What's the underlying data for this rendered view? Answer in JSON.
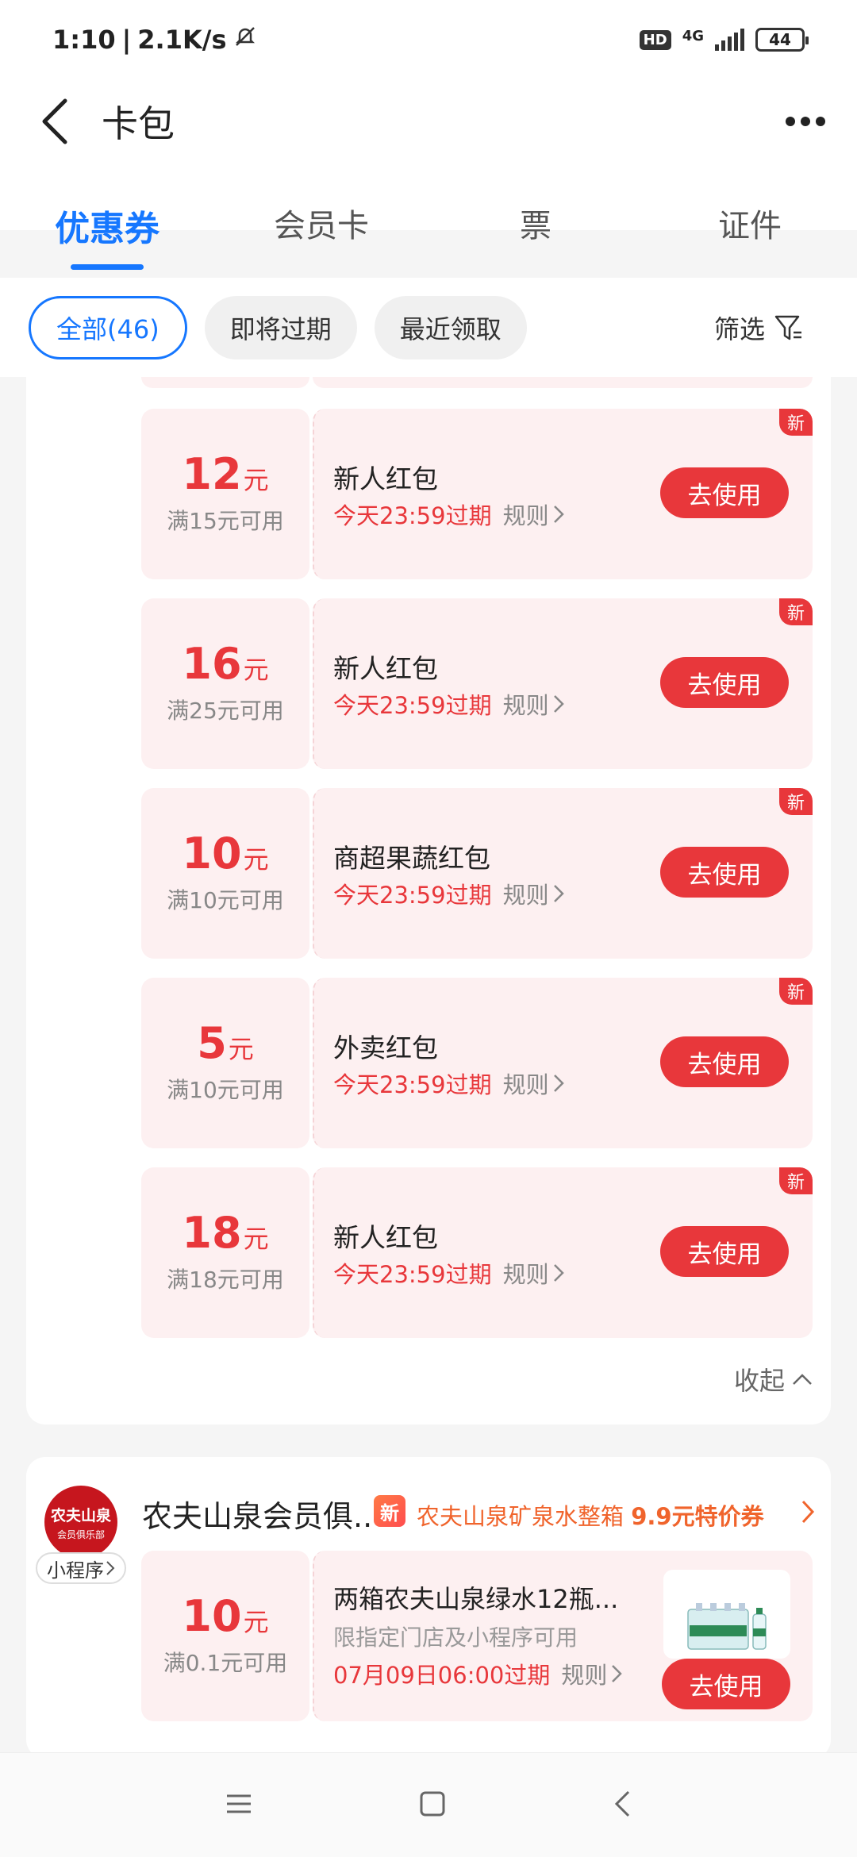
{
  "status_bar": {
    "time": "1:10",
    "speed": "2.1K/s",
    "hd": "HD",
    "network": "4G",
    "battery": "44"
  },
  "header": {
    "title": "卡包"
  },
  "tabs": [
    {
      "label": "优惠券",
      "active": true
    },
    {
      "label": "会员卡",
      "active": false
    },
    {
      "label": "票",
      "active": false
    },
    {
      "label": "证件",
      "active": false
    }
  ],
  "filters": {
    "chips": [
      "全部(46)",
      "即将过期",
      "最近领取"
    ],
    "filter_label": "筛选"
  },
  "coupons": [
    {
      "amount": "12",
      "unit": "元",
      "condition": "满15元可用",
      "name": "新人红包",
      "expire": "今天23:59过期",
      "rules": "规则",
      "button": "去使用",
      "badge": "新"
    },
    {
      "amount": "16",
      "unit": "元",
      "condition": "满25元可用",
      "name": "新人红包",
      "expire": "今天23:59过期",
      "rules": "规则",
      "button": "去使用",
      "badge": "新"
    },
    {
      "amount": "10",
      "unit": "元",
      "condition": "满10元可用",
      "name": "商超果蔬红包",
      "expire": "今天23:59过期",
      "rules": "规则",
      "button": "去使用",
      "badge": "新"
    },
    {
      "amount": "5",
      "unit": "元",
      "condition": "满10元可用",
      "name": "外卖红包",
      "expire": "今天23:59过期",
      "rules": "规则",
      "button": "去使用",
      "badge": "新"
    },
    {
      "amount": "18",
      "unit": "元",
      "condition": "满18元可用",
      "name": "新人红包",
      "expire": "今天23:59过期",
      "rules": "规则",
      "button": "去使用",
      "badge": "新"
    }
  ],
  "collapse_label": "收起",
  "merchant": {
    "logo_line1": "农夫山泉",
    "logo_line2": "会员俱乐部",
    "mini_program": "小程序",
    "name": "农夫山泉会员俱...",
    "promo_badge": "新",
    "promo_text": "农夫山泉矿泉水整箱",
    "promo_price": "9.9元特价券",
    "coupon": {
      "amount": "10",
      "unit": "元",
      "condition": "满0.1元可用",
      "name": "两箱农夫山泉绿水12瓶...",
      "sub": "限指定门店及小程序可用",
      "expire": "07月09日06:00过期",
      "rules": "规则",
      "button": "去使用"
    }
  }
}
